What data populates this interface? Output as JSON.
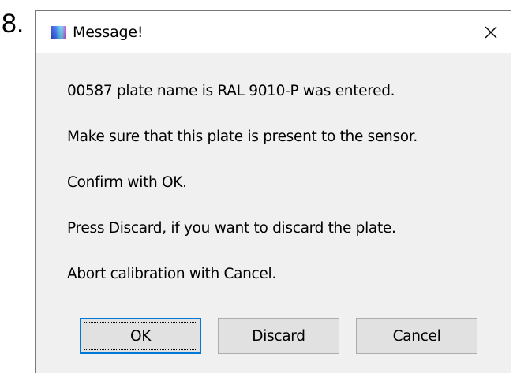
{
  "step_number": "8.",
  "dialog": {
    "title": "Message!",
    "icon": "app-icon",
    "close_icon": "close-icon",
    "messages": [
      "00587 plate name is RAL 9010-P was entered.",
      "Make sure that this plate is present to the sensor.",
      "Confirm with OK.",
      "Press Discard, if you want to discard the plate.",
      "Abort calibration with Cancel."
    ],
    "buttons": {
      "ok": "OK",
      "discard": "Discard",
      "cancel": "Cancel"
    },
    "focused_button": "ok"
  },
  "colors": {
    "focus_border": "#0078d7",
    "button_bg": "#e1e1e1",
    "dialog_bg": "#f0f0f0",
    "titlebar_bg": "#ffffff"
  }
}
